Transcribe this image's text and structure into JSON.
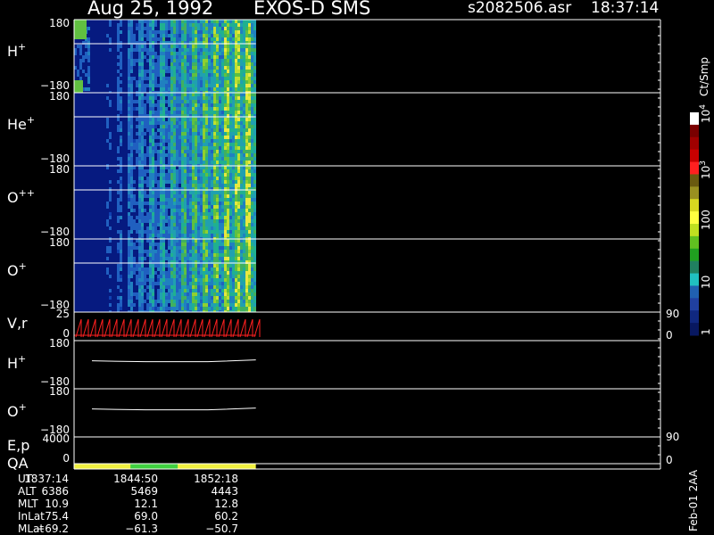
{
  "header": {
    "date": "Aug 25, 1992",
    "instrument": "EXOS-D SMS",
    "file": "s2082506.asr",
    "time": "18:37:14"
  },
  "colors": {
    "background": "#000000",
    "frame": "#ffffff",
    "spectrogram_base": "#061a80",
    "velocity_trace": "#ff2020",
    "qa_good": "#f0f040",
    "qa_alt": "#40d040"
  },
  "chart_data": {
    "type": "heatmap",
    "panels": [
      {
        "label": "H",
        "sup": "+",
        "y_top": "180",
        "y_bottom": "−180"
      },
      {
        "label": "He",
        "sup": "+",
        "y_top": "180",
        "y_bottom": "−180"
      },
      {
        "label": "O",
        "sup": "++",
        "y_top": "180",
        "y_bottom": "−180"
      },
      {
        "label": "O",
        "sup": "+",
        "y_top": "180",
        "y_bottom": "−180"
      }
    ],
    "vr_panel": {
      "label": "V,r",
      "y_top": "25",
      "y_bottom": "0",
      "right_top": "90",
      "right_bottom": "0"
    },
    "line_panels": [
      {
        "label": "H",
        "sup": "+",
        "y_top": "180",
        "y_bottom": "−180"
      },
      {
        "label": "O",
        "sup": "+",
        "y_top": "180",
        "y_bottom": "−180"
      }
    ],
    "ep_panel": {
      "label": "E,p",
      "y_top": "4000",
      "y_bottom": "0",
      "right_top": "90",
      "right_bottom": "0"
    },
    "qa_panel": {
      "label": "QA"
    },
    "colorbar": {
      "unit": "Ct/Smp",
      "ticks": [
        "10",
        "4",
        "10",
        "3",
        "100",
        "10",
        "1"
      ],
      "tick_values": [
        10000,
        1000,
        100,
        10,
        1
      ],
      "colors": [
        "#ffffff",
        "#7a0000",
        "#a00000",
        "#c80000",
        "#ff2020",
        "#6a5a10",
        "#9a9020",
        "#d8d820",
        "#ffff40",
        "#c0e020",
        "#60c020",
        "#20a020",
        "#208060",
        "#20c0c0",
        "#2060b0",
        "#2040a0",
        "#102880",
        "#081860"
      ]
    },
    "data_extent_fraction": 0.31,
    "orbit": {
      "rows": [
        {
          "name": "UT",
          "values": [
            "1837:14",
            "1844:50",
            "1852:18"
          ]
        },
        {
          "name": "ALT",
          "values": [
            "6386",
            "5469",
            "4443"
          ]
        },
        {
          "name": "MLT",
          "values": [
            "10.9",
            "12.1",
            "12.8"
          ]
        },
        {
          "name": "InLat",
          "values": [
            "75.4",
            "69.0",
            "60.2"
          ]
        },
        {
          "name": "MLat",
          "values": [
            "−69.2",
            "−61.3",
            "−50.7"
          ]
        }
      ]
    },
    "footer_stamp": "Feb-01 2AA"
  }
}
